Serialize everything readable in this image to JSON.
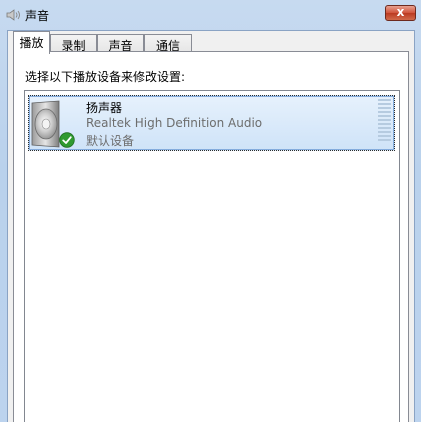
{
  "window": {
    "title": "声音",
    "close_label": "x"
  },
  "tabs": [
    {
      "label": "播放",
      "active": true
    },
    {
      "label": "录制",
      "active": false
    },
    {
      "label": "声音",
      "active": false
    },
    {
      "label": "通信",
      "active": false
    }
  ],
  "playback": {
    "instruction": "选择以下播放设备来修改设置:",
    "devices": [
      {
        "name": "扬声器",
        "description": "Realtek High Definition Audio",
        "status": "默认设备",
        "icon": "speaker-icon",
        "default_badge_icon": "check-icon",
        "selected": true
      }
    ]
  },
  "colors": {
    "title_bar": "#c7daf0",
    "close_button": "#c9452c",
    "selection_fill": "#d9e8f9",
    "check_green": "#2f9a2f"
  }
}
